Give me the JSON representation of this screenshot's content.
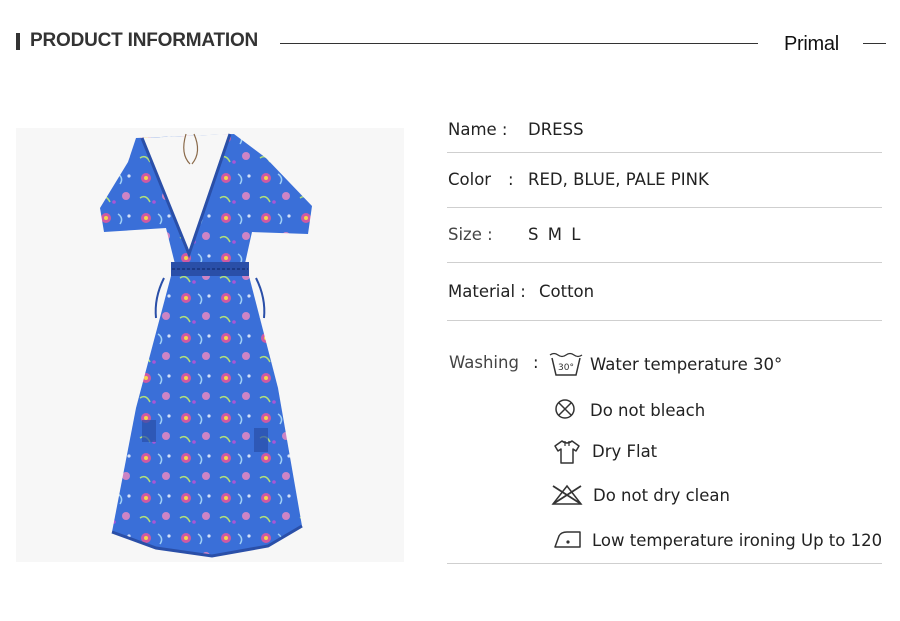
{
  "header": {
    "title": "PRODUCT INFORMATION",
    "brand": "Primal"
  },
  "product_image": {
    "alt": "dress",
    "colors": {
      "fabric": "#3a6fd8",
      "print": "#e8569a"
    }
  },
  "info": {
    "name": {
      "label": "Name :",
      "value": "DRESS"
    },
    "color": {
      "label": "Color",
      "colon": ":",
      "value": "RED, BLUE, PALE PINK"
    },
    "size": {
      "label": "Size :",
      "value": "S M L"
    },
    "material": {
      "label": "Material :",
      "value": "Cotton"
    }
  },
  "washing": {
    "label": "Washing",
    "colon": ":",
    "wash_icon_label": "30°",
    "items": [
      {
        "icon": "wash-30-icon",
        "text": "Water temperature 30°"
      },
      {
        "icon": "no-bleach-icon",
        "text": "Do not bleach"
      },
      {
        "icon": "dry-flat-icon",
        "text": "Dry Flat"
      },
      {
        "icon": "no-dry-clean-icon",
        "text": "Do not dry clean"
      },
      {
        "icon": "low-iron-icon",
        "text": "Low temperature ironing Up to 120"
      }
    ]
  }
}
